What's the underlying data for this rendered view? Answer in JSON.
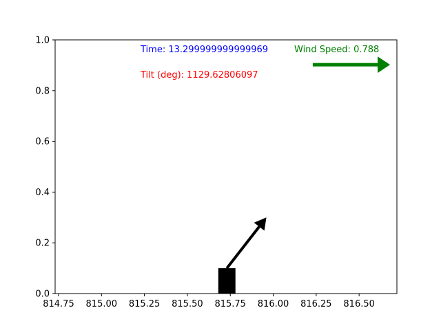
{
  "chart_data": {
    "type": "scatter",
    "title": "",
    "xlabel": "",
    "ylabel": "",
    "xlim": [
      814.73,
      816.72
    ],
    "ylim": [
      0.0,
      1.0
    ],
    "xticks": [
      "814.75",
      "815.00",
      "815.25",
      "815.50",
      "815.75",
      "816.00",
      "816.25",
      "816.50"
    ],
    "xtick_values": [
      814.75,
      815.0,
      815.25,
      815.5,
      815.75,
      816.0,
      816.25,
      816.5
    ],
    "yticks": [
      "0.0",
      "0.2",
      "0.4",
      "0.6",
      "0.8",
      "1.0"
    ],
    "ytick_values": [
      0.0,
      0.2,
      0.4,
      0.6,
      0.8,
      1.0
    ],
    "grid": false,
    "cart": {
      "x_center": 815.73,
      "half_width": 0.05,
      "height": 0.1,
      "color": "#000000"
    },
    "pole_arrow": {
      "x": 815.73,
      "y": 0.1,
      "dx": 0.23,
      "dy": 0.2,
      "color": "#000000"
    },
    "wind_arrow": {
      "x": 816.23,
      "y": 0.902,
      "dx": 0.45,
      "dy": 0.0,
      "color": "#008000"
    },
    "annotations": {
      "time": {
        "text": "Time: 13.299999999999969",
        "color": "#0000ff"
      },
      "tilt": {
        "text": "Tilt (deg): 1129.62806097",
        "color": "#ff0000"
      },
      "wind": {
        "text": "Wind Speed: 0.788",
        "color": "#008000"
      }
    }
  }
}
